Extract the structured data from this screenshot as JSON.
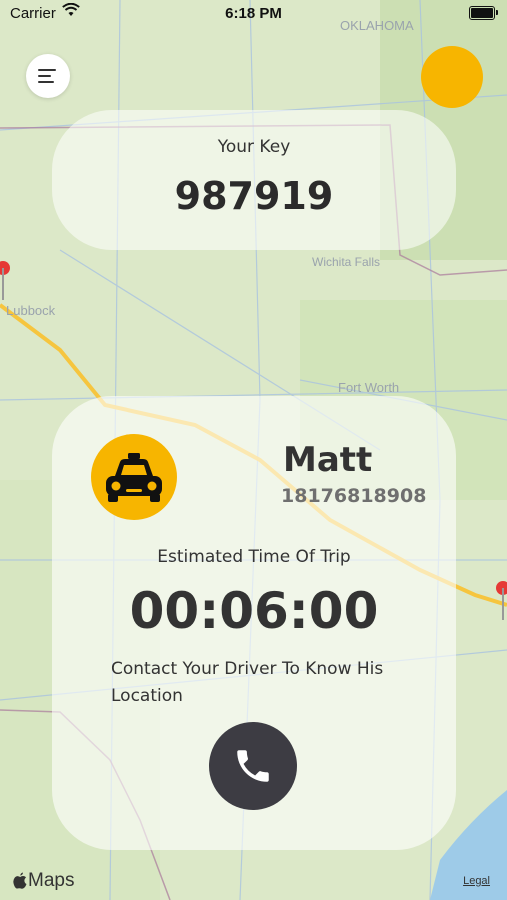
{
  "status_bar": {
    "carrier": "Carrier",
    "time": "6:18 PM"
  },
  "map": {
    "labels": [
      "OKLAHOMA",
      "Lubbock",
      "Wichita Falls",
      "Fort Worth"
    ],
    "route_color": "#f8c12f",
    "pin_color": "#e53935"
  },
  "key_card": {
    "label": "Your Key",
    "value": "987919"
  },
  "trip_card": {
    "driver_name": "Matt",
    "driver_phone": "18176818908",
    "eta_label": "Estimated Time Of Trip",
    "eta_value": "00:06:00",
    "contact_text": "Contact Your Driver To Know His Location"
  },
  "footer": {
    "maps_label": "Maps",
    "legal": "Legal"
  },
  "colors": {
    "accent": "#f7b500",
    "call_button": "#3d3c43"
  }
}
